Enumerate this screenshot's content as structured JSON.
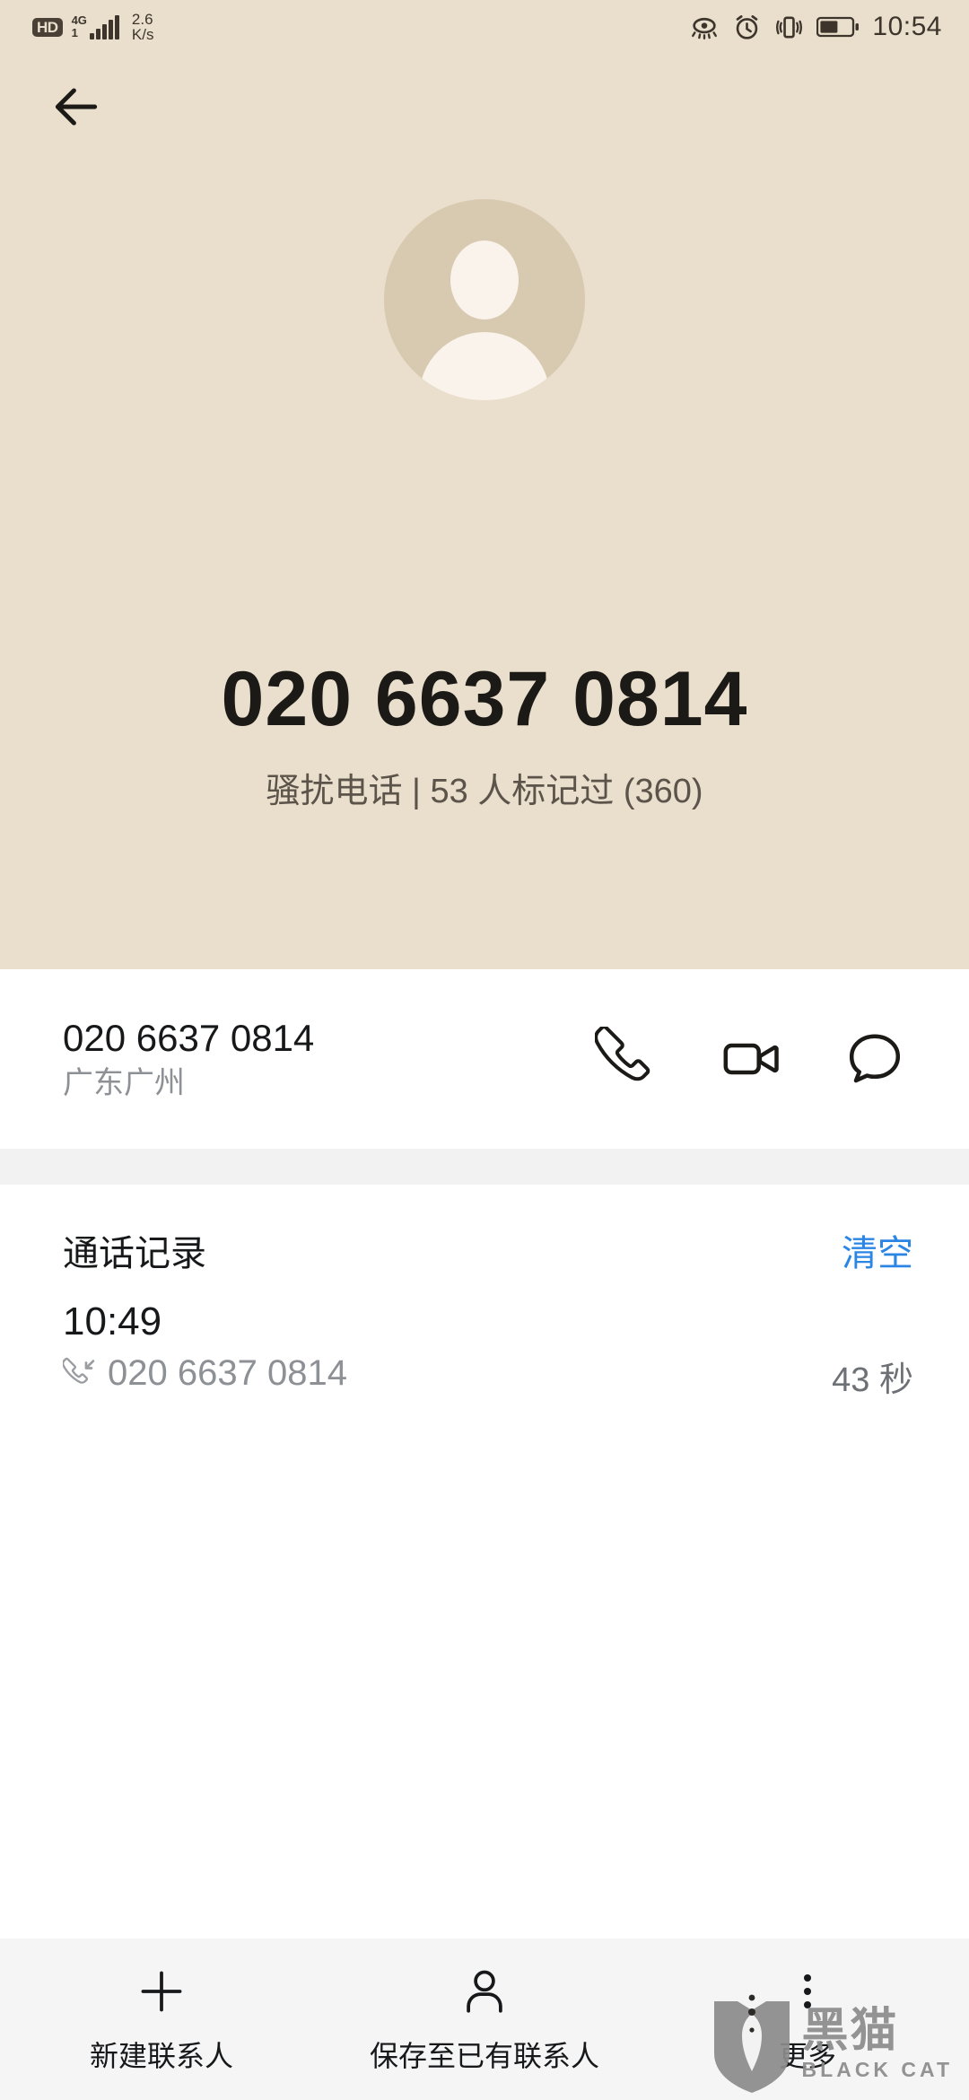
{
  "statusbar": {
    "hd_label": "HD",
    "network_type": "4G",
    "sim_index": "1",
    "net_speed_value": "2.6",
    "net_speed_unit": "K/s",
    "icons": [
      "eye-comfort-icon",
      "alarm-icon",
      "vibrate-icon",
      "battery-icon"
    ],
    "battery_percent": 55,
    "time": "10:54"
  },
  "hero": {
    "back_icon": "back-arrow-icon",
    "avatar_icon": "default-contact-avatar",
    "number": "020 6637 0814",
    "subtitle": "骚扰电话 | 53 人标记过 (360)",
    "spam_label": "骚扰电话",
    "mark_count_text": "53 人标记过",
    "source": "(360)",
    "background_color": "#eadfcd"
  },
  "contact_card": {
    "number": "020 6637 0814",
    "location": "广东广州",
    "actions": [
      {
        "name": "call-icon",
        "label": "拨打电话"
      },
      {
        "name": "video-call-icon",
        "label": "视频通话"
      },
      {
        "name": "message-icon",
        "label": "发送信息"
      }
    ]
  },
  "call_log": {
    "title": "通话记录",
    "clear_label": "清空",
    "clear_color": "#2b85e4",
    "entries": [
      {
        "time": "10:49",
        "direction_icon": "incoming-call-icon",
        "number": "020 6637 0814",
        "duration": "43 秒"
      }
    ]
  },
  "bottom_bar": {
    "items": [
      {
        "icon": "plus-icon",
        "label": "新建联系人"
      },
      {
        "icon": "person-icon",
        "label": "保存至已有联系人"
      },
      {
        "icon": "more-dots-icon",
        "label": "更多"
      }
    ]
  },
  "watermark": {
    "cn": "黑猫",
    "en": "BLACK CAT",
    "icon": "black-cat-shield-logo"
  }
}
